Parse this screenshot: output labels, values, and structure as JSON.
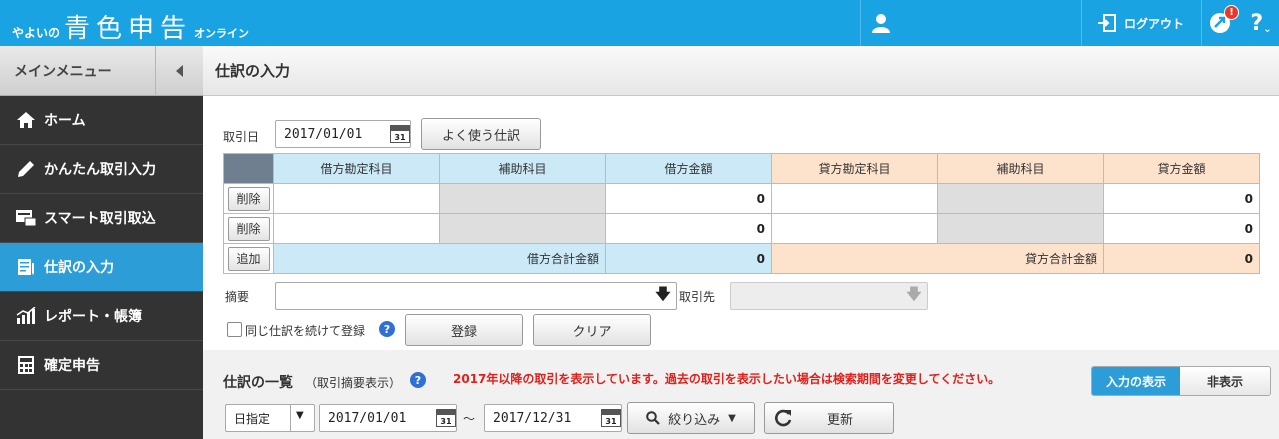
{
  "header": {
    "brand_prefix": "やよいの",
    "brand_main": "青色申告",
    "brand_suffix": "オンライン",
    "logout_label": "ログアウト",
    "notification_badge": "!",
    "help_label": "?"
  },
  "sidebar": {
    "menu_title": "メインメニュー",
    "items": [
      {
        "label": "ホーム",
        "icon": "home-icon"
      },
      {
        "label": "かんたん取引入力",
        "icon": "pencil-icon"
      },
      {
        "label": "スマート取引取込",
        "icon": "import-icon"
      },
      {
        "label": "仕訳の入力",
        "icon": "journal-icon",
        "active": true
      },
      {
        "label": "レポート・帳簿",
        "icon": "chart-icon"
      },
      {
        "label": "確定申告",
        "icon": "calculator-icon"
      }
    ]
  },
  "page": {
    "title": "仕訳の入力"
  },
  "entry": {
    "date_label": "取引日",
    "date_value": "2017/01/01",
    "calendar_day": "31",
    "frequent_button": "よく使う仕訳",
    "columns": {
      "debit_account": "借方勘定科目",
      "debit_sub": "補助科目",
      "debit_amount": "借方金額",
      "credit_account": "貸方勘定科目",
      "credit_sub": "補助科目",
      "credit_amount": "貸方金額"
    },
    "rows": [
      {
        "action": "削除",
        "debit_amount": "0",
        "credit_amount": "0"
      },
      {
        "action": "削除",
        "debit_amount": "0",
        "credit_amount": "0"
      }
    ],
    "add_button": "追加",
    "debit_total_label": "借方合計金額",
    "debit_total": "0",
    "credit_total_label": "貸方合計金額",
    "credit_total": "0",
    "summary_label": "摘要",
    "partner_label": "取引先",
    "repeat_label": "同じ仕訳を続けて登録",
    "register_button": "登録",
    "clear_button": "クリア"
  },
  "list": {
    "title": "仕訳の一覧",
    "subtitle": "（取引摘要表示）",
    "notice": "2017年以降の取引を表示しています。過去の取引を表示したい場合は検索期間を変更してください。",
    "toggle_show": "入力の表示",
    "toggle_hide": "非表示",
    "period_type": "日指定",
    "date_from": "2017/01/01",
    "range_sep": "～",
    "date_to": "2017/12/31",
    "filter_button": "絞り込み",
    "refresh_button": "更新"
  },
  "colors": {
    "topbar": "#1aa3e3",
    "sidebar": "#333333",
    "active_nav": "#2d9dd7",
    "debit_header": "#cbe9f6",
    "credit_header": "#fde2cc",
    "notice_red": "#e0201b"
  }
}
